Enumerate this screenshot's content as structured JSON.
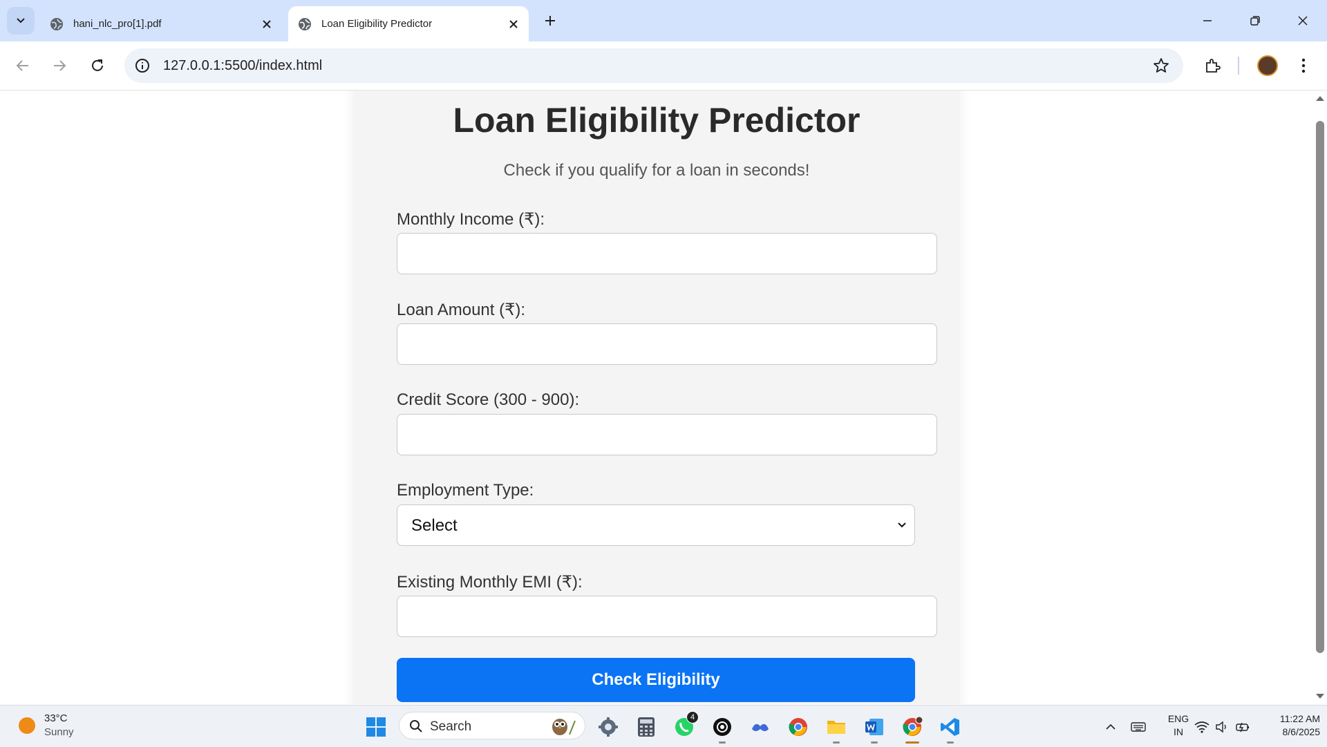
{
  "browser": {
    "tabs": [
      {
        "title": "hani_nlc_pro[1].pdf",
        "active": false
      },
      {
        "title": "Loan Eligibility Predictor",
        "active": true
      }
    ],
    "url": "127.0.0.1:5500/index.html"
  },
  "page": {
    "title": "Loan Eligibility Predictor",
    "subtitle": "Check if you qualify for a loan in seconds!",
    "fields": {
      "income_label": "Monthly Income (₹):",
      "income_value": "",
      "loan_label": "Loan Amount (₹):",
      "loan_value": "",
      "credit_label": "Credit Score (300 - 900):",
      "credit_value": "",
      "employment_label": "Employment Type:",
      "employment_selected": "Select",
      "emi_label": "Existing Monthly EMI (₹):",
      "emi_value": ""
    },
    "submit_label": "Check Eligibility",
    "accent_color": "#0a74f4"
  },
  "taskbar": {
    "weather_temp": "33°C",
    "weather_condition": "Sunny",
    "search_placeholder": "Search",
    "whatsapp_badge": "4",
    "language_line1": "ENG",
    "language_line2": "IN",
    "time": "11:22 AM",
    "date": "8/6/2025",
    "apps": [
      "start-icon",
      "search",
      "settings-icon",
      "calculator-icon",
      "whatsapp-icon",
      "chatgpt-icon",
      "copilot-icon",
      "chrome-icon",
      "file-explorer-icon",
      "word-icon",
      "chrome-profile-icon",
      "vscode-icon"
    ]
  }
}
